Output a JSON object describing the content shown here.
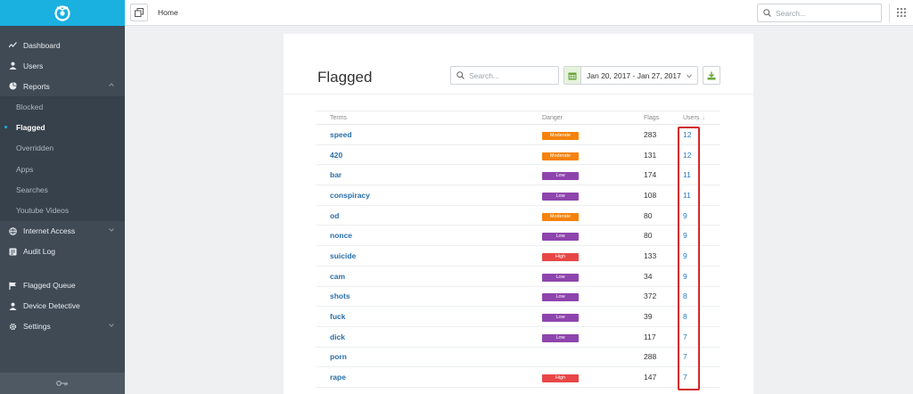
{
  "topbar": {
    "title": "Home",
    "search_placeholder": "Search..."
  },
  "sidebar": {
    "items": [
      {
        "label": "Dashboard",
        "icon": "chart-line-icon"
      },
      {
        "label": "Users",
        "icon": "user-icon"
      },
      {
        "label": "Reports",
        "icon": "pie-chart-icon"
      }
    ],
    "reports_sub": [
      {
        "label": "Blocked"
      },
      {
        "label": "Flagged"
      },
      {
        "label": "Overridden"
      },
      {
        "label": "Apps"
      },
      {
        "label": "Searches"
      },
      {
        "label": "Youtube Videos"
      }
    ],
    "items2": [
      {
        "label": "Internet Access",
        "icon": "globe-icon"
      },
      {
        "label": "Audit Log",
        "icon": "list-icon"
      }
    ],
    "items3": [
      {
        "label": "Flagged Queue",
        "icon": "flag-icon"
      },
      {
        "label": "Device Detective",
        "icon": "user-icon"
      },
      {
        "label": "Settings",
        "icon": "gear-icon"
      }
    ]
  },
  "card": {
    "title": "Flagged",
    "search_placeholder": "Search...",
    "date_range": "Jan 20, 2017 - Jan 27, 2017"
  },
  "table": {
    "headers": {
      "terms": "Terms",
      "danger": "Danger",
      "flags": "Flags",
      "users": "Users"
    },
    "rows": [
      {
        "term": "speed",
        "danger": "Moderate",
        "flags": "283",
        "users": "12"
      },
      {
        "term": "420",
        "danger": "Moderate",
        "flags": "131",
        "users": "12"
      },
      {
        "term": "bar",
        "danger": "Low",
        "flags": "174",
        "users": "11"
      },
      {
        "term": "conspiracy",
        "danger": "Low",
        "flags": "108",
        "users": "11"
      },
      {
        "term": "od",
        "danger": "Moderate",
        "flags": "80",
        "users": "9"
      },
      {
        "term": "nonce",
        "danger": "Low",
        "flags": "80",
        "users": "9"
      },
      {
        "term": "suicide",
        "danger": "High",
        "flags": "133",
        "users": "9"
      },
      {
        "term": "cam",
        "danger": "Low",
        "flags": "34",
        "users": "9"
      },
      {
        "term": "shots",
        "danger": "Low",
        "flags": "372",
        "users": "8"
      },
      {
        "term": "fuck",
        "danger": "Low",
        "flags": "39",
        "users": "8"
      },
      {
        "term": "dick",
        "danger": "Low",
        "flags": "117",
        "users": "7"
      },
      {
        "term": "porn",
        "danger": "",
        "flags": "288",
        "users": "7"
      },
      {
        "term": "rape",
        "danger": "High",
        "flags": "147",
        "users": "7"
      }
    ]
  },
  "colors": {
    "brand": "#1ab0e0",
    "moderate": "#f5820b",
    "low": "#8e44ad",
    "high": "#e84646",
    "highlight": "#d2262a"
  }
}
